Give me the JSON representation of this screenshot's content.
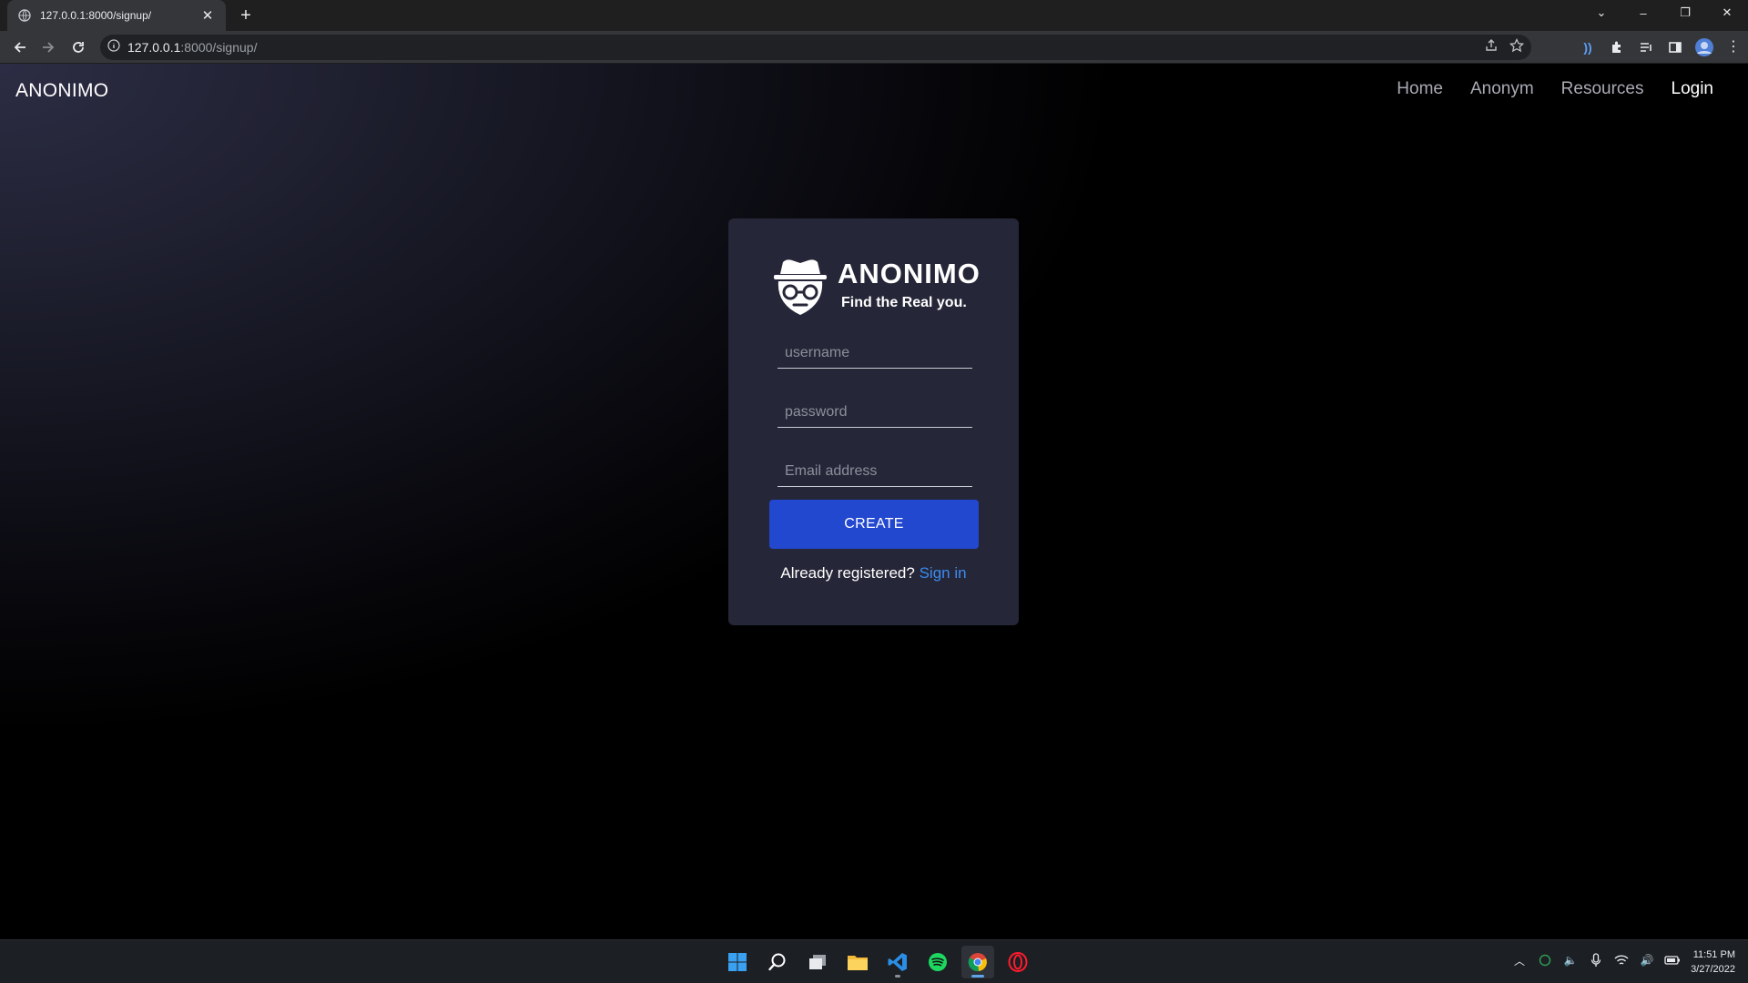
{
  "browser": {
    "tab_title": "127.0.0.1:8000/signup/",
    "url_host": "127.0.0.1",
    "url_rest": ":8000/signup/"
  },
  "site": {
    "brand": "ANONIMO",
    "nav": [
      {
        "label": "Home"
      },
      {
        "label": "Anonym"
      },
      {
        "label": "Resources"
      },
      {
        "label": "Login"
      }
    ]
  },
  "card": {
    "logo_name": "ANONIMO",
    "logo_tagline": "Find the Real you.",
    "username_placeholder": "username",
    "password_placeholder": "password",
    "email_placeholder": "Email address",
    "create_label": "CREATE",
    "signin_prompt": "Already registered?",
    "signin_link": "Sign in"
  },
  "taskbar": {
    "time": "11:51 PM",
    "date": "3/27/2022"
  },
  "colors": {
    "button": "#2348d0",
    "link": "#3b8cf0",
    "card": "#252637"
  }
}
